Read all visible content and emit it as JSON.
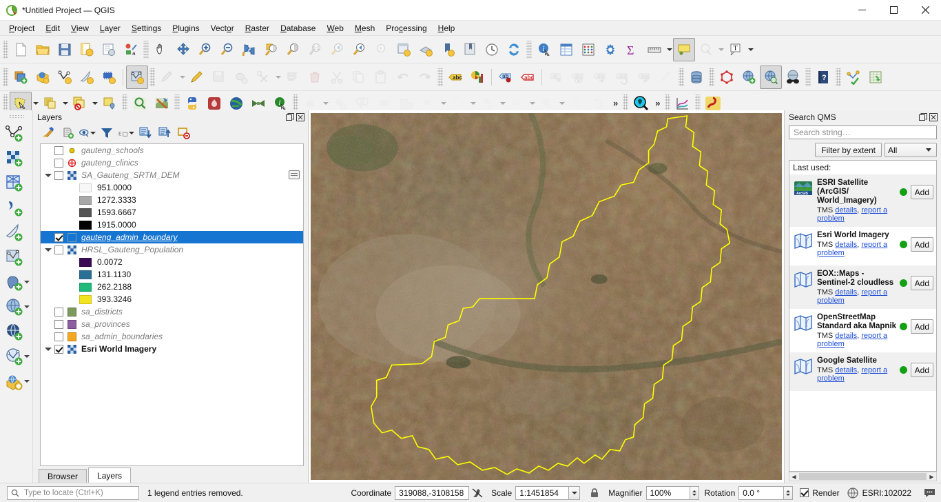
{
  "window": {
    "title": "*Untitled Project — QGIS",
    "minimize_label": "Minimize",
    "maximize_label": "Maximize",
    "close_label": "Close"
  },
  "menubar": {
    "items": [
      {
        "label": "Project",
        "mnemonic": "P"
      },
      {
        "label": "Edit",
        "mnemonic": "E"
      },
      {
        "label": "View",
        "mnemonic": "V"
      },
      {
        "label": "Layer",
        "mnemonic": "L"
      },
      {
        "label": "Settings",
        "mnemonic": "S"
      },
      {
        "label": "Plugins",
        "mnemonic": "P"
      },
      {
        "label": "Vector",
        "mnemonic": "o"
      },
      {
        "label": "Raster",
        "mnemonic": "R"
      },
      {
        "label": "Database",
        "mnemonic": "D"
      },
      {
        "label": "Web",
        "mnemonic": "W"
      },
      {
        "label": "Mesh",
        "mnemonic": "M"
      },
      {
        "label": "Processing",
        "mnemonic": "c"
      },
      {
        "label": "Help",
        "mnemonic": "H"
      }
    ]
  },
  "toolbars": {
    "row1": [
      "new-project-icon",
      "open-project-icon",
      "save-project-icon",
      "save-project-as-icon",
      "new-print-layout-icon",
      "style-manager-icon",
      "pan-map-icon",
      "pan-to-selection-icon",
      "zoom-in-icon",
      "zoom-out-icon",
      "zoom-full-icon",
      "zoom-to-selection-icon",
      "zoom-to-layer-icon",
      "zoom-native-icon",
      "zoom-last-icon",
      "zoom-next-icon",
      "new-map-view-icon",
      "new-3d-map-view-icon",
      "new-bookmark-icon",
      "show-bookmarks-icon",
      "temporal-controller-icon",
      "refresh-icon",
      "identify-features-icon",
      "open-attribute-table-icon",
      "field-calculator-icon",
      "options-icon",
      "statistical-summary-icon",
      "measure-line-icon",
      "map-tips-icon",
      "show-unplaced-labels-icon",
      "text-annotation-icon"
    ],
    "row2": [
      "current-edits-icon",
      "add-layer-definition-icon",
      "add-vector-layer-icon",
      "add-delimited-text-icon",
      "add-mesh-layer-icon",
      "open-data-source-manager-icon",
      "toggle-editing-icon",
      "edit-pencil-icon",
      "save-layer-edits-icon",
      "add-feature-icon",
      "vertex-tool-icon",
      "modify-attributes-icon",
      "delete-selected-icon",
      "cut-features-icon",
      "copy-features-icon",
      "paste-features-icon",
      "undo-icon",
      "redo-icon",
      "label-icon",
      "diagram-icon",
      "pin-labels-icon",
      "highlight-labels-icon",
      "move-label-icon",
      "show-hide-labels-icon",
      "move-label-right-icon",
      "rotate-label-icon",
      "change-label-icon",
      "change-label-properties-icon",
      "db-manager-icon",
      "new-shapefile-icon",
      "add-wms-layer-icon",
      "metasearch-icon",
      "georeferencer-icon",
      "help-icon",
      "qgis-plugin-icon",
      "processing-toolbox-icon"
    ],
    "row3": [
      "select-features-icon",
      "deselect-icon",
      "select-all-icon",
      "select-by-location-icon",
      "zoom-last-search-icon",
      "styling-panel-icon",
      "python-console-icon",
      "qgis-brand-icon",
      "globe-plugin-icon",
      "mesh-plugin-icon",
      "info-plugin-icon",
      "geoprocessing-buffer-icon",
      "clip-icon",
      "intersect-icon",
      "dissolve-icon",
      "union-icon",
      "symmetric-difference-icon",
      "difference-icon",
      "convex-hull-icon",
      "eliminate-icon",
      "simplify-icon",
      "densify-icon",
      "qms-search-icon",
      "plot-icon",
      "serval-icon"
    ],
    "overflow_label": "»"
  },
  "vertical_toolbar": {
    "items": [
      "add-vector-layer-icon",
      "add-raster-layer-icon",
      "add-mesh-layer-icon",
      "add-delimited-text-layer-icon",
      "add-spatialite-layer-icon",
      "add-vector-tile-layer-icon",
      "add-postgis-layer-icon",
      "add-wms-wmts-layer-icon",
      "add-xyz-layer-icon",
      "add-wfs-layer-icon",
      "add-arcgis-layer-icon"
    ]
  },
  "layers_panel": {
    "title": "Layers",
    "undock_label": "Undock panel",
    "close_label": "Close panel",
    "toolbar": [
      "open-layer-styling-icon",
      "add-group-icon",
      "manage-map-themes-icon",
      "filter-legend-icon",
      "filter-legend-expression-icon",
      "expand-all-icon",
      "collapse-all-icon",
      "remove-layer-icon"
    ],
    "tabs": [
      {
        "label": "Browser",
        "active": false
      },
      {
        "label": "Layers",
        "active": true
      }
    ],
    "tree": [
      {
        "type": "layer",
        "name": "gauteng_schools",
        "checked": false,
        "expandable": false,
        "selected": false,
        "style": "italic",
        "symbol": "point-circle",
        "color": "#e3c700"
      },
      {
        "type": "layer",
        "name": "gauteng_clinics",
        "checked": false,
        "expandable": false,
        "selected": false,
        "style": "italic",
        "symbol": "point-cross",
        "color": "#e02020"
      },
      {
        "type": "layer",
        "name": "SA_Gauteng_SRTM_DEM",
        "checked": false,
        "expandable": true,
        "selected": false,
        "style": "italic",
        "symbol": "raster",
        "has_raster_button": true,
        "children": [
          {
            "label": "951.0000",
            "color": "#f7f7f7"
          },
          {
            "label": "1272.3333",
            "color": "#a8a8a8"
          },
          {
            "label": "1593.6667",
            "color": "#545454"
          },
          {
            "label": "1915.0000",
            "color": "#000000"
          }
        ]
      },
      {
        "type": "layer",
        "name": "gauteng_admin_boundary",
        "checked": true,
        "expandable": false,
        "selected": true,
        "style": "italic",
        "symbol": "polygon-outline",
        "color": "#5f8fb0"
      },
      {
        "type": "layer",
        "name": "HRSL_Gauteng_Population",
        "checked": false,
        "expandable": true,
        "selected": false,
        "style": "italic",
        "symbol": "raster",
        "children": [
          {
            "label": "0.0072",
            "color": "#3b0a54"
          },
          {
            "label": "131.1130",
            "color": "#2a6f94"
          },
          {
            "label": "262.2188",
            "color": "#21b97a"
          },
          {
            "label": "393.3246",
            "color": "#f2e420"
          }
        ]
      },
      {
        "type": "layer",
        "name": "sa_districts",
        "checked": false,
        "expandable": false,
        "selected": false,
        "style": "italic",
        "symbol": "polygon-fill",
        "color": "#7c9a5e"
      },
      {
        "type": "layer",
        "name": "sa_provinces",
        "checked": false,
        "expandable": false,
        "selected": false,
        "style": "italic",
        "symbol": "polygon-fill",
        "color": "#8b5ea0"
      },
      {
        "type": "layer",
        "name": "sa_admin_boundaries",
        "checked": false,
        "expandable": false,
        "selected": false,
        "style": "italic",
        "symbol": "polygon-fill",
        "color": "#f5a623"
      },
      {
        "type": "layer",
        "name": "Esri World Imagery",
        "checked": true,
        "expandable": true,
        "selected": false,
        "style": "bold",
        "symbol": "raster"
      }
    ]
  },
  "qms_panel": {
    "title": "Search QMS",
    "undock_label": "Undock panel",
    "close_label": "Close panel",
    "search_placeholder": "Search string…",
    "search_value": "",
    "filter_by_extent_label": "Filter by extent",
    "type_filter_value": "All",
    "last_used_label": "Last used:",
    "add_label": "Add",
    "tms_label": "TMS",
    "details_label": "details",
    "report_label": "report a problem",
    "status_color": "#14a014",
    "results": [
      {
        "name": "ESRI Satellite (ArcGIS/ World_Imagery)",
        "type": "TMS",
        "icon": "arcgis-thumb-icon"
      },
      {
        "name": "Esri World Imagery",
        "type": "TMS",
        "icon": "map-thumb-icon"
      },
      {
        "name": "EOX::Maps - Sentinel-2 cloudless",
        "type": "TMS",
        "icon": "map-thumb-icon"
      },
      {
        "name": "OpenStreetMap Standard aka Mapnik",
        "type": "TMS",
        "icon": "map-thumb-icon"
      },
      {
        "name": "Google Satellite",
        "type": "TMS",
        "icon": "map-thumb-icon"
      }
    ]
  },
  "map": {
    "background_color": "#7a5c3c",
    "boundary_color": "#ffff00",
    "layer_name": "gauteng_admin_boundary"
  },
  "statusbar": {
    "locator_placeholder": "Type to locate (Ctrl+K)",
    "locator_value": "",
    "message": "1 legend entries removed.",
    "coordinate_label": "Coordinate",
    "coordinate_value": "319088,-3108158",
    "scale_label": "Scale",
    "scale_value": "1:1451854",
    "magnifier_label": "Magnifier",
    "magnifier_value": "100%",
    "rotation_label": "Rotation",
    "rotation_value": "0.0 °",
    "render_label": "Render",
    "render_checked": true,
    "crs_value": "ESRI:102022",
    "lock_icon": "lock-icon",
    "crs_icon": "globe-icon",
    "messages_icon": "message-bubble-icon",
    "coordinate_capture_icon": "coordinate-capture-icon"
  }
}
